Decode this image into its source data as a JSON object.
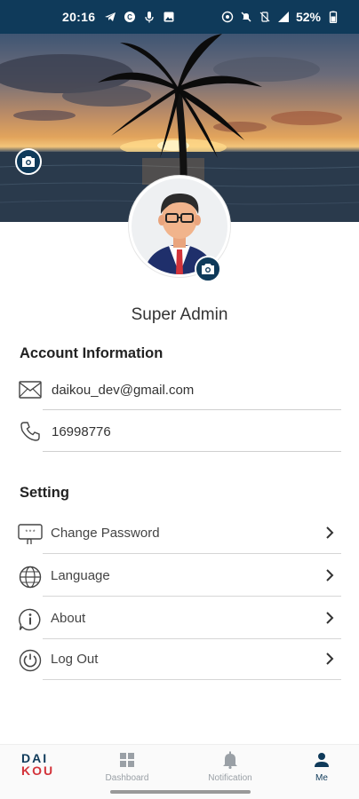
{
  "status_bar": {
    "time": "20:16",
    "battery": "52%"
  },
  "profile": {
    "name": "Super Admin"
  },
  "account_info": {
    "title": "Account Information",
    "email": "daikou_dev@gmail.com",
    "phone": "16998776"
  },
  "settings": {
    "title": "Setting",
    "items": [
      {
        "label": "Change Password",
        "icon": "password-icon"
      },
      {
        "label": "Language",
        "icon": "globe-icon"
      },
      {
        "label": "About",
        "icon": "info-icon"
      },
      {
        "label": "Log Out",
        "icon": "power-icon"
      }
    ]
  },
  "bottom_nav": {
    "logo_top": "DAI",
    "logo_bottom": "KOU",
    "items": [
      {
        "label": "Dashboard",
        "icon": "dashboard-icon",
        "active": false
      },
      {
        "label": "Notification",
        "icon": "bell-icon",
        "active": false
      },
      {
        "label": "Me",
        "icon": "person-icon",
        "active": true
      }
    ]
  },
  "colors": {
    "primary": "#0f3a5a",
    "accent_red": "#d3333a",
    "inactive": "#9aa0a6"
  }
}
